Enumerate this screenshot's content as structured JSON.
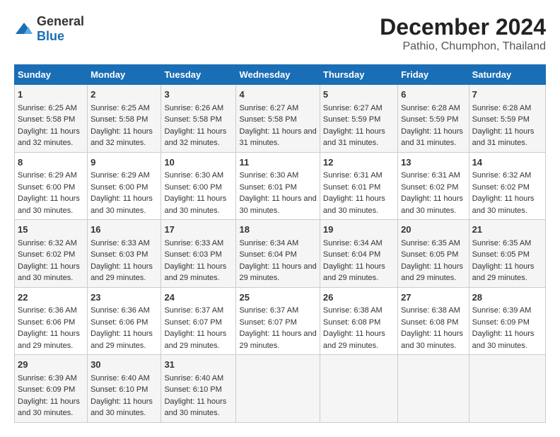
{
  "logo": {
    "general": "General",
    "blue": "Blue"
  },
  "title": "December 2024",
  "subtitle": "Pathio, Chumphon, Thailand",
  "headers": [
    "Sunday",
    "Monday",
    "Tuesday",
    "Wednesday",
    "Thursday",
    "Friday",
    "Saturday"
  ],
  "weeks": [
    [
      {
        "day": "1",
        "sunrise": "6:25 AM",
        "sunset": "5:58 PM",
        "daylight": "11 hours and 32 minutes."
      },
      {
        "day": "2",
        "sunrise": "6:25 AM",
        "sunset": "5:58 PM",
        "daylight": "11 hours and 32 minutes."
      },
      {
        "day": "3",
        "sunrise": "6:26 AM",
        "sunset": "5:58 PM",
        "daylight": "11 hours and 32 minutes."
      },
      {
        "day": "4",
        "sunrise": "6:27 AM",
        "sunset": "5:58 PM",
        "daylight": "11 hours and 31 minutes."
      },
      {
        "day": "5",
        "sunrise": "6:27 AM",
        "sunset": "5:59 PM",
        "daylight": "11 hours and 31 minutes."
      },
      {
        "day": "6",
        "sunrise": "6:28 AM",
        "sunset": "5:59 PM",
        "daylight": "11 hours and 31 minutes."
      },
      {
        "day": "7",
        "sunrise": "6:28 AM",
        "sunset": "5:59 PM",
        "daylight": "11 hours and 31 minutes."
      }
    ],
    [
      {
        "day": "8",
        "sunrise": "6:29 AM",
        "sunset": "6:00 PM",
        "daylight": "11 hours and 30 minutes."
      },
      {
        "day": "9",
        "sunrise": "6:29 AM",
        "sunset": "6:00 PM",
        "daylight": "11 hours and 30 minutes."
      },
      {
        "day": "10",
        "sunrise": "6:30 AM",
        "sunset": "6:00 PM",
        "daylight": "11 hours and 30 minutes."
      },
      {
        "day": "11",
        "sunrise": "6:30 AM",
        "sunset": "6:01 PM",
        "daylight": "11 hours and 30 minutes."
      },
      {
        "day": "12",
        "sunrise": "6:31 AM",
        "sunset": "6:01 PM",
        "daylight": "11 hours and 30 minutes."
      },
      {
        "day": "13",
        "sunrise": "6:31 AM",
        "sunset": "6:02 PM",
        "daylight": "11 hours and 30 minutes."
      },
      {
        "day": "14",
        "sunrise": "6:32 AM",
        "sunset": "6:02 PM",
        "daylight": "11 hours and 30 minutes."
      }
    ],
    [
      {
        "day": "15",
        "sunrise": "6:32 AM",
        "sunset": "6:02 PM",
        "daylight": "11 hours and 30 minutes."
      },
      {
        "day": "16",
        "sunrise": "6:33 AM",
        "sunset": "6:03 PM",
        "daylight": "11 hours and 29 minutes."
      },
      {
        "day": "17",
        "sunrise": "6:33 AM",
        "sunset": "6:03 PM",
        "daylight": "11 hours and 29 minutes."
      },
      {
        "day": "18",
        "sunrise": "6:34 AM",
        "sunset": "6:04 PM",
        "daylight": "11 hours and 29 minutes."
      },
      {
        "day": "19",
        "sunrise": "6:34 AM",
        "sunset": "6:04 PM",
        "daylight": "11 hours and 29 minutes."
      },
      {
        "day": "20",
        "sunrise": "6:35 AM",
        "sunset": "6:05 PM",
        "daylight": "11 hours and 29 minutes."
      },
      {
        "day": "21",
        "sunrise": "6:35 AM",
        "sunset": "6:05 PM",
        "daylight": "11 hours and 29 minutes."
      }
    ],
    [
      {
        "day": "22",
        "sunrise": "6:36 AM",
        "sunset": "6:06 PM",
        "daylight": "11 hours and 29 minutes."
      },
      {
        "day": "23",
        "sunrise": "6:36 AM",
        "sunset": "6:06 PM",
        "daylight": "11 hours and 29 minutes."
      },
      {
        "day": "24",
        "sunrise": "6:37 AM",
        "sunset": "6:07 PM",
        "daylight": "11 hours and 29 minutes."
      },
      {
        "day": "25",
        "sunrise": "6:37 AM",
        "sunset": "6:07 PM",
        "daylight": "11 hours and 29 minutes."
      },
      {
        "day": "26",
        "sunrise": "6:38 AM",
        "sunset": "6:08 PM",
        "daylight": "11 hours and 29 minutes."
      },
      {
        "day": "27",
        "sunrise": "6:38 AM",
        "sunset": "6:08 PM",
        "daylight": "11 hours and 30 minutes."
      },
      {
        "day": "28",
        "sunrise": "6:39 AM",
        "sunset": "6:09 PM",
        "daylight": "11 hours and 30 minutes."
      }
    ],
    [
      {
        "day": "29",
        "sunrise": "6:39 AM",
        "sunset": "6:09 PM",
        "daylight": "11 hours and 30 minutes."
      },
      {
        "day": "30",
        "sunrise": "6:40 AM",
        "sunset": "6:10 PM",
        "daylight": "11 hours and 30 minutes."
      },
      {
        "day": "31",
        "sunrise": "6:40 AM",
        "sunset": "6:10 PM",
        "daylight": "11 hours and 30 minutes."
      },
      null,
      null,
      null,
      null
    ]
  ],
  "labels": {
    "sunrise": "Sunrise:",
    "sunset": "Sunset:",
    "daylight": "Daylight:"
  }
}
